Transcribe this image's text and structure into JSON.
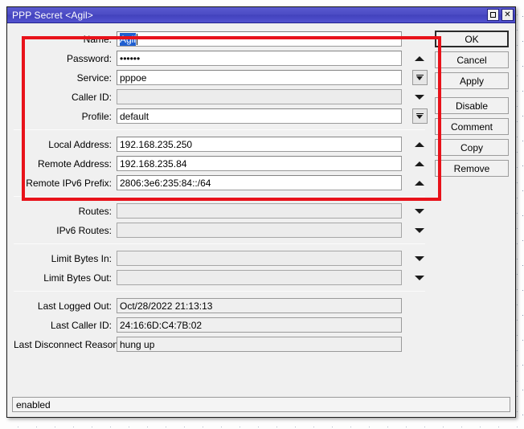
{
  "window": {
    "title": "PPP Secret <Agil>",
    "controls": [
      {
        "name": "maximize",
        "glyph": "□"
      },
      {
        "name": "close",
        "glyph": "✕"
      }
    ]
  },
  "form": {
    "groups": [
      {
        "id": "identity",
        "rows": [
          {
            "label": "Name:",
            "value": "Agil",
            "state": "selected",
            "widget": "none"
          },
          {
            "label": "Password:",
            "value": "••••••",
            "state": "normal",
            "widget": "triangle-up"
          },
          {
            "label": "Service:",
            "value": "pppoe",
            "state": "normal",
            "widget": "combo"
          },
          {
            "label": "Caller ID:",
            "value": "",
            "state": "dim",
            "widget": "triangle-down"
          },
          {
            "label": "Profile:",
            "value": "default",
            "state": "normal",
            "widget": "combo"
          }
        ]
      },
      {
        "id": "addressing",
        "rows": [
          {
            "label": "Local Address:",
            "value": "192.168.235.250",
            "state": "normal",
            "widget": "triangle-up"
          },
          {
            "label": "Remote Address:",
            "value": "192.168.235.84",
            "state": "normal",
            "widget": "triangle-up"
          },
          {
            "label": "Remote IPv6 Prefix:",
            "value": "2806:3e6:235:84::/64",
            "state": "normal",
            "widget": "triangle-up"
          }
        ]
      },
      {
        "id": "routes",
        "rows": [
          {
            "label": "Routes:",
            "value": "",
            "state": "dim",
            "widget": "triangle-down"
          },
          {
            "label": "IPv6 Routes:",
            "value": "",
            "state": "dim",
            "widget": "triangle-down"
          }
        ]
      },
      {
        "id": "limits",
        "rows": [
          {
            "label": "Limit Bytes In:",
            "value": "",
            "state": "dim",
            "widget": "triangle-down"
          },
          {
            "label": "Limit Bytes Out:",
            "value": "",
            "state": "dim",
            "widget": "triangle-down"
          }
        ]
      },
      {
        "id": "last-session",
        "rows": [
          {
            "label": "Last Logged Out:",
            "value": "Oct/28/2022 21:13:13",
            "state": "readonly",
            "widget": "none"
          },
          {
            "label": "Last Caller ID:",
            "value": "24:16:6D:C4:7B:02",
            "state": "readonly",
            "widget": "none"
          },
          {
            "label": "Last Disconnect Reason:",
            "value": "hung up",
            "state": "readonly",
            "widget": "none"
          }
        ]
      }
    ]
  },
  "buttons": [
    {
      "label": "OK",
      "default": true,
      "gap": false
    },
    {
      "label": "Cancel",
      "default": false,
      "gap": false
    },
    {
      "label": "Apply",
      "default": false,
      "gap": false
    },
    {
      "label": "Disable",
      "default": false,
      "gap": true
    },
    {
      "label": "Comment",
      "default": false,
      "gap": false
    },
    {
      "label": "Copy",
      "default": false,
      "gap": false
    },
    {
      "label": "Remove",
      "default": false,
      "gap": false
    }
  ],
  "statusbar": {
    "text": "enabled"
  },
  "annotation": {
    "color": "#e8121a",
    "shape": "rectangle"
  }
}
